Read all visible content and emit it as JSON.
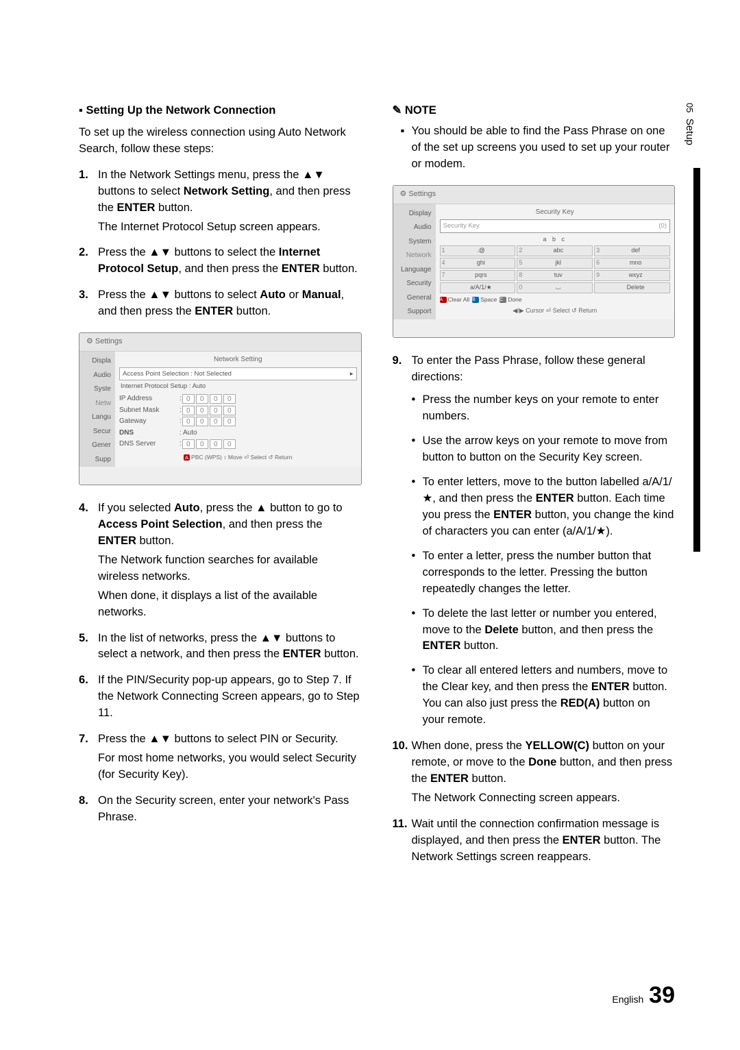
{
  "chapter_tab": {
    "num": "05",
    "title": "Setup"
  },
  "footer": {
    "lang": "English",
    "page": "39"
  },
  "left": {
    "heading": "Setting Up the Network Connection",
    "intro": "To set up the wireless connection using Auto Network Search, follow these steps:",
    "s1a": "In the Network Settings menu, press the ▲▼ buttons to select ",
    "s1b_bold": "Network Setting",
    "s1c": ", and then press the ",
    "s1d_bold": "ENTER",
    "s1e": " button.",
    "s1f": "The Internet Protocol Setup screen appears.",
    "s2a": "Press the ▲▼ buttons to select the ",
    "s2b_bold": "Internet Protocol Setup",
    "s2c": ", and then press the ",
    "s2d_bold": "ENTER",
    "s2e": " button.",
    "s3a": "Press the ▲▼ buttons to select ",
    "s3b_bold": "Auto",
    "s3c": " or ",
    "s3d_bold": "Manual",
    "s3e": ", and then press the ",
    "s3f_bold": "ENTER",
    "s3g": " button.",
    "s4a": "If you selected ",
    "s4b_bold": "Auto",
    "s4c": ", press the ▲ button to go to ",
    "s4d_bold": "Access Point Selection",
    "s4e": ", and then press the ",
    "s4f_bold": "ENTER",
    "s4g": " button.",
    "s4h": "The Network function searches for available wireless networks.",
    "s4i": "When done, it displays a list of the available networks.",
    "s5a": "In the list of networks, press the ▲▼ buttons to select a network, and then press the ",
    "s5b_bold": "ENTER",
    "s5c": " button.",
    "s6": "If the PIN/Security pop-up appears, go to Step 7. If the Network Connecting Screen appears, go to Step 11.",
    "s7a": "Press the ▲▼ buttons to select PIN or Security.",
    "s7b": "For most home networks, you would select Security (for Security Key).",
    "s8": "On the Security screen, enter your network's Pass Phrase."
  },
  "right": {
    "note_head": "NOTE",
    "note1": "You should be able to find the Pass Phrase on one of the set up screens you used to set up your router or modem.",
    "s9": "To enter the Pass Phrase, follow these general directions:",
    "b1": "Press the number keys on your remote to enter numbers.",
    "b2": "Use the arrow keys on your remote to move from button to button on the Security Key screen.",
    "b3a": "To enter letters, move to the button labelled a/A/1/★, and then press the ",
    "b3b_bold": "ENTER",
    "b3c": " button. Each time you press the ",
    "b3d_bold": "ENTER",
    "b3e": " button, you change the kind of characters you can enter (a/A/1/★).",
    "b4": "To enter a letter, press the number button that corresponds to the letter. Pressing the button repeatedly changes the letter.",
    "b5a": "To delete the last letter or number you entered, move to the ",
    "b5b_bold": "Delete",
    "b5c": " button, and then press the ",
    "b5d_bold": "ENTER",
    "b5e": " button.",
    "b6a": "To clear all entered letters and numbers, move to the Clear key, and then press the ",
    "b6b_bold": "ENTER",
    "b6c": " button. You can also just press the ",
    "b6d_bold": "RED(A)",
    "b6e": " button on your remote.",
    "s10a": "When done, press the ",
    "s10b_bold": "YELLOW(C)",
    "s10c": " button on your remote, or move to the ",
    "s10d_bold": "Done",
    "s10e": " button, and then press the ",
    "s10f_bold": "ENTER",
    "s10g": " button.",
    "s10h": "The Network Connecting screen appears.",
    "s11a": "Wait until the connection confirmation message is displayed, and then press the ",
    "s11b_bold": "ENTER",
    "s11c": " button. The Network Settings screen reappears."
  },
  "ui1": {
    "title": "Settings",
    "panel_title": "Network Setting",
    "sidebar": [
      "Displa",
      "Audio",
      "Syste",
      "Netw",
      "Langu",
      "Secur",
      "Gener",
      "Supp"
    ],
    "ap_label": "Access Point Selection  : Not Selected",
    "ips_label": "Internet Protocol Setup  : Auto",
    "rows": [
      "IP Address",
      "Subnet Mask",
      "Gateway"
    ],
    "dns_label": "DNS",
    "dns_value": ": Auto",
    "dns_server": "DNS Server",
    "footer": "PBC (WPS)    ↕ Move    ⏎ Select    ↺ Return",
    "footer_tag": "A"
  },
  "ui2": {
    "title": "Settings",
    "panel_title": "Security Key",
    "sidebar": [
      "Display",
      "Audio",
      "System",
      "Network",
      "Language",
      "Security",
      "General",
      "Support"
    ],
    "input_placeholder": "Security Key",
    "input_count": "(0)",
    "abc": "a  b  c",
    "keys": [
      {
        "n": "1",
        "t": ".@"
      },
      {
        "n": "2",
        "t": "abc"
      },
      {
        "n": "3",
        "t": "def"
      },
      {
        "n": "4",
        "t": "ghi"
      },
      {
        "n": "5",
        "t": "jkl"
      },
      {
        "n": "6",
        "t": "mno"
      },
      {
        "n": "7",
        "t": "pqrs"
      },
      {
        "n": "8",
        "t": "tuv"
      },
      {
        "n": "9",
        "t": "wxyz"
      },
      {
        "n": "",
        "t": "a/A/1/★"
      },
      {
        "n": "0",
        "t": "⌴"
      },
      {
        "n": "",
        "t": "Delete"
      }
    ],
    "legend": [
      {
        "tag": "A",
        "cls": "a",
        "text": "Clear All"
      },
      {
        "tag": "B",
        "cls": "b",
        "text": "Space"
      },
      {
        "tag": "C",
        "cls": "c",
        "text": "Done"
      }
    ],
    "hints": "◀/▶ Cursor    ⏎ Select    ↺ Return"
  }
}
